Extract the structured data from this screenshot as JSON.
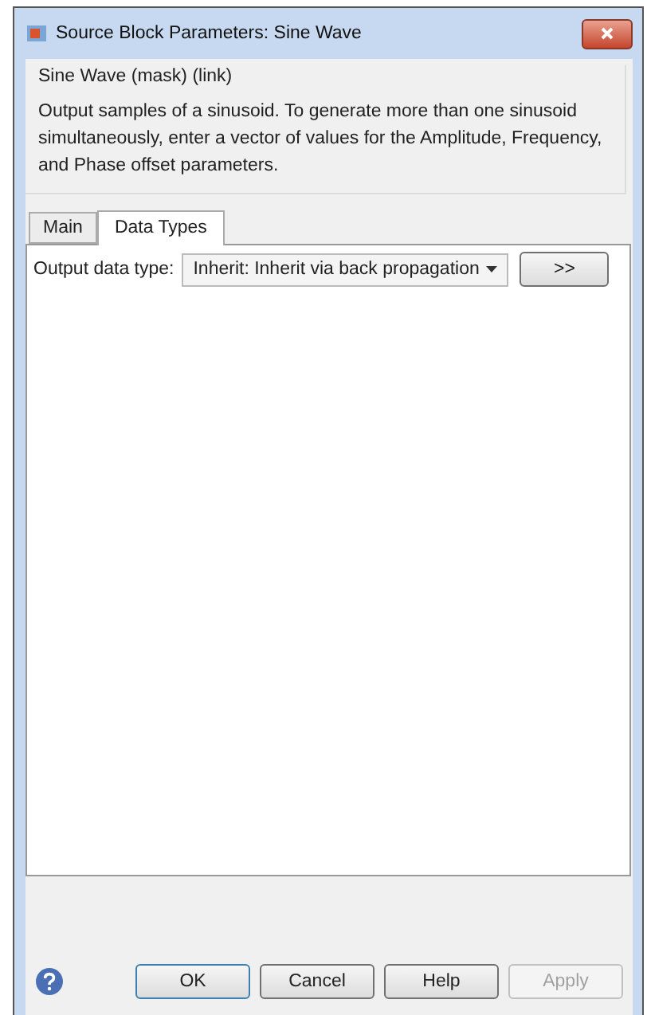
{
  "window": {
    "title": "Source Block Parameters: Sine Wave"
  },
  "group": {
    "title": "Sine Wave (mask) (link)",
    "description": "Output samples of a sinusoid.  To generate more than one sinusoid simultaneously, enter a vector of values for the Amplitude, Frequency, and Phase offset parameters."
  },
  "tabs": [
    {
      "label": "Main",
      "selected": false
    },
    {
      "label": "Data Types",
      "selected": true
    }
  ],
  "output_data_type": {
    "label": "Output data type:",
    "value": "Inherit: Inherit via back propagation",
    "assistant_button": ">>"
  },
  "buttons": [
    {
      "label": "OK",
      "default": true,
      "disabled": false
    },
    {
      "label": "Cancel",
      "default": false,
      "disabled": false
    },
    {
      "label": "Help",
      "default": false,
      "disabled": false
    },
    {
      "label": "Apply",
      "default": false,
      "disabled": true
    }
  ]
}
